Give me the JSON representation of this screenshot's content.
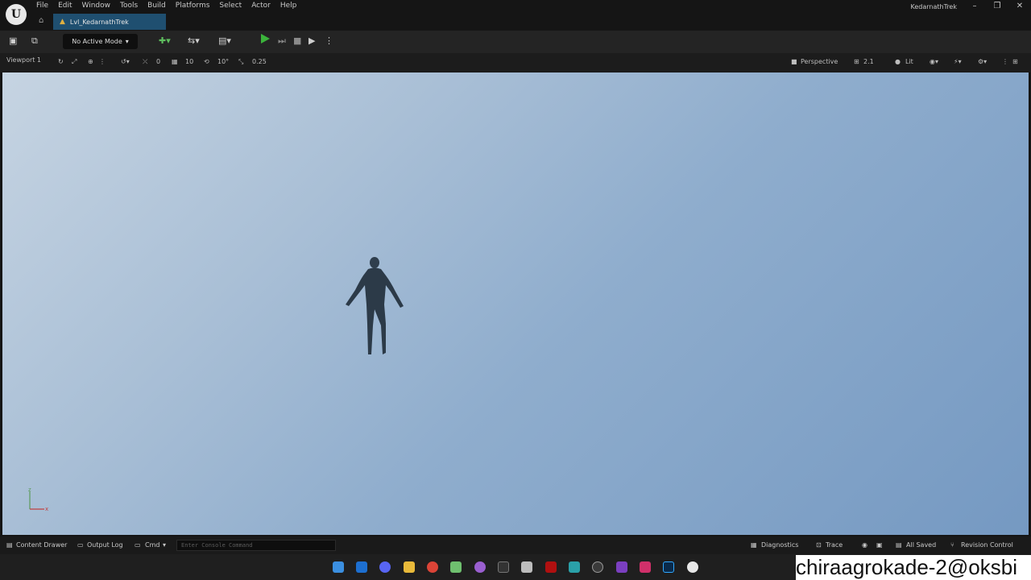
{
  "app": {
    "menu": [
      "File",
      "Edit",
      "Window",
      "Tools",
      "Build",
      "Platforms",
      "Select",
      "Actor",
      "Help"
    ],
    "project_name": "KedarnathTrek",
    "level_tab": "Lvl_KedarnathTrek"
  },
  "toolbar": {
    "mode_label": "No Active Mode"
  },
  "viewport_toolbar": {
    "viewport_name": "Viewport 1",
    "rotation_snap": "0",
    "grid_snap": "10",
    "angle_snap": "10°",
    "scale_snap": "0.25",
    "view_mode": "Perspective",
    "fov": "2.1",
    "lighting": "Lit"
  },
  "viewport": {
    "axis_z": "z",
    "axis_x": "x",
    "sky_colors": [
      "#c6d4e2",
      "#7599c2"
    ]
  },
  "statusbar": {
    "content_drawer": "Content Drawer",
    "output_log": "Output Log",
    "cmd": "Cmd",
    "console_placeholder": "Enter Console Command",
    "diagnostics": "Diagnostics",
    "trace": "Trace",
    "all_saved": "All Saved",
    "revision_control": "Revision Control"
  },
  "taskbar": {
    "icons": [
      "windows-start",
      "outlook",
      "discord",
      "file-explorer",
      "chrome",
      "notepad",
      "github",
      "terminal",
      "visual-studio",
      "netflix",
      "3ds-max",
      "obs",
      "visual-studio-purple",
      "snip",
      "photoshop",
      "unreal-engine"
    ]
  },
  "watermark": "chiraagrokade-2@oksbi"
}
